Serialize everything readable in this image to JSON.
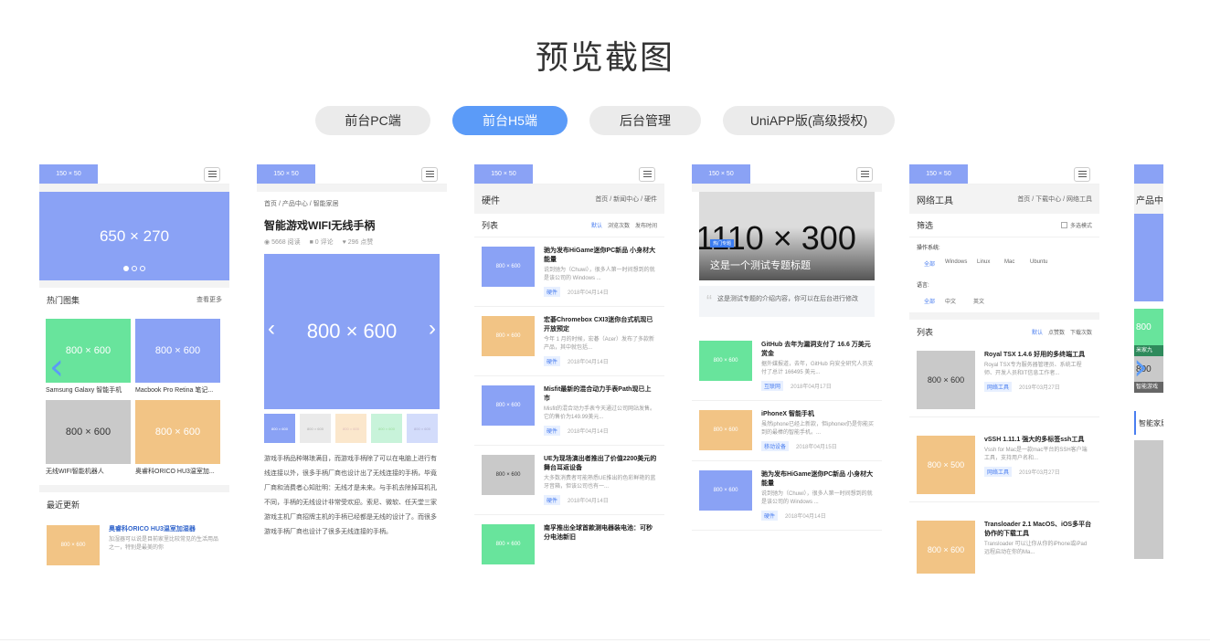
{
  "title": "预览截图",
  "tabs": [
    {
      "label": "前台PC端",
      "active": false
    },
    {
      "label": "前台H5端",
      "active": true
    },
    {
      "label": "后台管理",
      "active": false
    },
    {
      "label": "UniAPP版(高级授权)",
      "active": false
    }
  ],
  "common": {
    "logo": "150 × 50"
  },
  "colors": {
    "accent": "#5b9bf8",
    "placeholder_blue": "#8aa2f5",
    "placeholder_green": "#68e49c",
    "placeholder_gray": "#c9c9c9",
    "placeholder_orange": "#f2c485"
  },
  "s1": {
    "banner": "650 × 270",
    "hot_title": "热门图集",
    "hot_more": "查看更多",
    "grid": [
      {
        "ph": "800 × 600",
        "caption": "Samsung Galaxy 智能手机"
      },
      {
        "ph": "800 × 600",
        "caption": "Macbook Pro Retina 笔记..."
      },
      {
        "ph": "800 × 600",
        "caption": "无线WIFI智能机器人"
      },
      {
        "ph": "800 × 600",
        "caption": "奥睿科ORICO HU3温室加..."
      }
    ],
    "recent_title": "最近更新",
    "recent": {
      "ph": "800 × 600",
      "title": "奥睿科ORICO HU3温室加湿器",
      "desc": "加湿器可以说是目前家里比较常见的生活用品之一，特别是最美的你"
    }
  },
  "s2": {
    "crumbs": [
      "首页",
      "产品中心",
      "智能家居"
    ],
    "title": "智能游戏WIFI无线手柄",
    "views": "5668 阅读",
    "comments": "0 评论",
    "likes": "296 点赞",
    "image": "800 × 600",
    "thumbs": [
      "800 × 600",
      "800 × 600",
      "800 × 600",
      "800 × 600",
      "800 × 600"
    ],
    "body": "游戏手柄品种琳琅满目，而游戏手柄除了可以在电脑上进行有线连接以外，很多手柄厂商也设计出了无线连接的手柄，毕竟厂商和消费者心知肚明：无线才是未来。与手机去除掉耳机孔不同，手柄的无线设计非常受欢迎。索尼、微软、任天堂三家游戏主机厂商招牌主机的手柄已经都是无线的设计了。而很多游戏手柄厂商也设计了很多无线连接的手柄。"
  },
  "s3": {
    "section": "硬件",
    "crumbs": [
      "首页",
      "新闻中心",
      "硬件"
    ],
    "list_title": "列表",
    "sorts": [
      "默认",
      "浏览次数",
      "发布时间"
    ],
    "items": [
      {
        "ph": "800 × 600",
        "title": "驰为发布HiGame迷你PC新品 小身材大能量",
        "desc": "说到驰为（Chuwi），很多人第一时间想到的就是该公司的 Windows ...",
        "tag": "硬件",
        "date": "2018年04月14日"
      },
      {
        "ph": "800 × 600",
        "title": "宏碁Chromebox CXI3迷你台式机现已开放预定",
        "desc": "今年 1 月的时候，宏碁（Acer）发布了多款新产品，其中就包括...",
        "tag": "硬件",
        "date": "2018年04月14日"
      },
      {
        "ph": "800 × 600",
        "title": "Misfit最新的混合动力手表Path现已上市",
        "desc": "Misfit的混合动力手表今天通过公司网站发售。它的售价为149.99美元...",
        "tag": "硬件",
        "date": "2018年04月14日"
      },
      {
        "ph": "800 × 600",
        "title": "UE为现场演出者推出了价值2200美元的舞台耳返设备",
        "desc": "大多数消费者可能熟悉UE推出的色彩鲜艳的蓝牙音箱，但该公司也有一...",
        "tag": "硬件",
        "date": "2018年04月14日"
      },
      {
        "ph": "800 × 600",
        "title": "南孚推出全球首款测电器装电池：可秒分电池新旧",
        "desc": "",
        "tag": "",
        "date": ""
      }
    ]
  },
  "s4": {
    "banner": "1110 × 300",
    "banner_tag": "热门专题",
    "banner_title": "这是一个测试专题标题",
    "intro": "这是测试专题的介绍内容，你可以在后台进行修改",
    "items": [
      {
        "ph": "800 × 600",
        "title": "GitHub 去年为漏洞支付了 16.6 万美元赏金",
        "desc": "据外媒报道，去年，GitHub 向安全研究人员支付了总计 166495 美元...",
        "tag": "互联网",
        "date": "2018年04月17日"
      },
      {
        "ph": "800 × 600",
        "title": "iPhoneX 智能手机",
        "desc": "虽然iphone已经上新款，但iphonex仍是你能买到的最棒的智能手机。...",
        "tag": "移动设备",
        "date": "2018年04月15日"
      },
      {
        "ph": "800 × 600",
        "title": "驰为发布HiGame迷你PC新品 小身材大能量",
        "desc": "说到驰为（Chuwi），很多人第一时间想到的就是该公司的 Windows ...",
        "tag": "硬件",
        "date": "2018年04月14日"
      }
    ]
  },
  "s5": {
    "section": "网络工具",
    "crumbs": [
      "首页",
      "下载中心",
      "网络工具"
    ],
    "filter_title": "筛选",
    "multi": "多选模式",
    "os_label": "操作系统:",
    "os": [
      "全部",
      "Windows",
      "Linux",
      "Mac",
      "Ubuntu"
    ],
    "lang_label": "语言:",
    "langs": [
      "全部",
      "中文",
      "英文"
    ],
    "list_title": "列表",
    "sorts": [
      "默认",
      "点赞数",
      "下载次数"
    ],
    "items": [
      {
        "ph": "800 × 600",
        "title": "Royal TSX 1.4.6 好用的多终端工具",
        "desc": "Royal TSX专为服务器管理员、系统工程师、开发人员和IT信息工作者...",
        "tag": "网络工具",
        "date": "2019年03月27日"
      },
      {
        "ph": "800 × 500",
        "title": "vSSH 1.11.1 强大的多标签ssh工具",
        "desc": "Vssh for Mac是一款mac平台的SSH客户端工具，支持用户名和...",
        "tag": "网络工具",
        "date": "2019年03月27日"
      },
      {
        "ph": "800 × 600",
        "title": "Transloader 2.1 MacOS、iOS多平台协作的下载工具",
        "desc": "Transloader 可以让你从你的iPhone或iPad远程启动在你的Ma...",
        "tag": "网络工具",
        "date": "2019年03月27日"
      }
    ]
  },
  "s6": {
    "title": "产品中心",
    "ph1": "800",
    "caption": "米家九",
    "ph2": "800",
    "caption2": "智能游戏",
    "section": "智能家居"
  }
}
